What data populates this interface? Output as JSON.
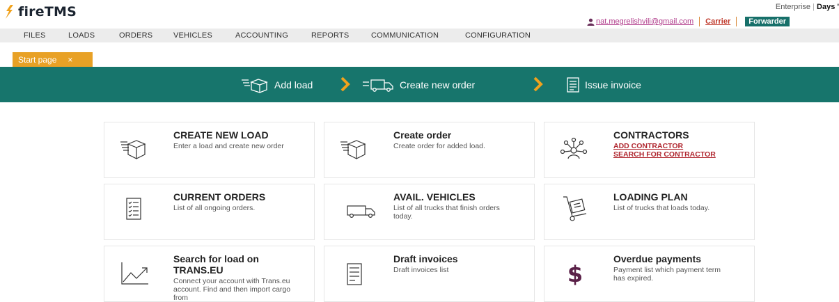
{
  "app": {
    "name": "fireTMS"
  },
  "topright": {
    "edition": "Enterprise",
    "days": "Days '"
  },
  "user": {
    "email": "nat.megrelishvili@gmail.com",
    "carrier": "Carrier",
    "forwarder": "Forwarder"
  },
  "menu": [
    "FILES",
    "LOADS",
    "ORDERS",
    "VEHICLES",
    "ACCOUNTING",
    "REPORTS",
    "COMMUNICATION",
    "CONFIGURATION"
  ],
  "tab": {
    "label": "Start page",
    "close": "×"
  },
  "steps": [
    "Add load",
    "Create new order",
    "Issue invoice"
  ],
  "cards": [
    {
      "icon": "box-icon",
      "title": "CREATE NEW LOAD",
      "desc": "Enter a load and create new order"
    },
    {
      "icon": "box-icon",
      "title": "Create order",
      "desc": "Create order for added load."
    },
    {
      "icon": "contractors-icon",
      "title": "CONTRACTORS",
      "links": [
        "ADD CONTRACTOR",
        "SEARCH FOR CONTRACTOR"
      ]
    },
    {
      "icon": "checklist-icon",
      "title": "CURRENT ORDERS",
      "desc": "List of all ongoing orders."
    },
    {
      "icon": "truck-icon",
      "title": "AVAIL. VEHICLES",
      "desc": "List of all trucks that finish orders today."
    },
    {
      "icon": "hand-truck-icon",
      "title": "LOADING PLAN",
      "desc": "List of trucks that loads today."
    },
    {
      "icon": "chart-up-icon",
      "title": "Search for load on TRANS.EU",
      "desc": "Connect your account with Trans.eu account. Find and then import cargo from"
    },
    {
      "icon": "invoice-icon",
      "title": "Draft invoices",
      "desc": "Draft invoices list"
    },
    {
      "icon": "dollar-icon",
      "title": "Overdue payments",
      "desc": "Payment list which payment term has expired."
    }
  ]
}
